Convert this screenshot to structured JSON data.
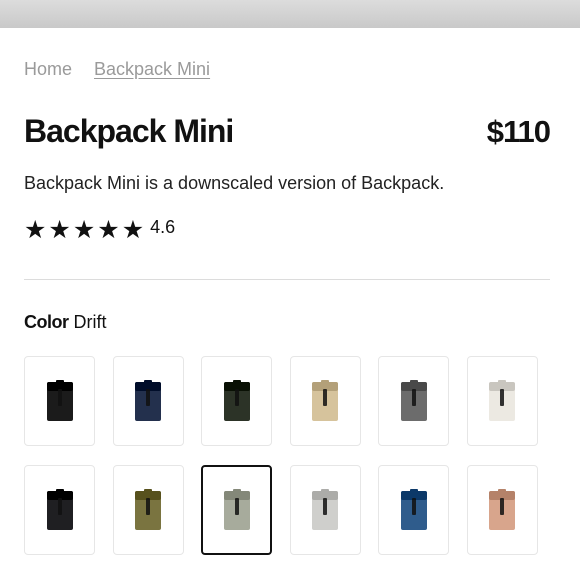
{
  "breadcrumb": {
    "home": "Home",
    "current": "Backpack Mini"
  },
  "product": {
    "title": "Backpack Mini",
    "price": "$110",
    "description": "Backpack Mini is a downscaled version of Backpack.",
    "rating": {
      "value": "4.6",
      "stars_filled": 5,
      "stars_total": 5
    }
  },
  "color": {
    "label": "Color",
    "selected": "Drift",
    "swatches": [
      {
        "color": "#1b1b1b"
      },
      {
        "color": "#23304d"
      },
      {
        "color": "#2c3327"
      },
      {
        "color": "#d6c39c"
      },
      {
        "color": "#6c6c6c"
      },
      {
        "color": "#ece9e2"
      },
      {
        "color": "#1f1f22"
      },
      {
        "color": "#7a7440"
      },
      {
        "color": "#a7ab9c",
        "selected": true
      },
      {
        "color": "#cfcfcc"
      },
      {
        "color": "#2f5c8c"
      },
      {
        "color": "#d8a58c"
      }
    ]
  }
}
